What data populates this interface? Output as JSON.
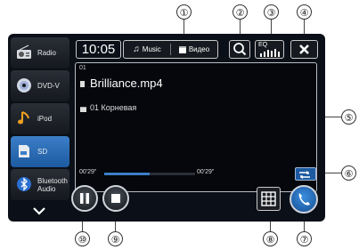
{
  "status": {
    "clock": "10:05"
  },
  "sources": [
    {
      "label": "Radio",
      "icon": "radio-icon",
      "active": false
    },
    {
      "label": "DVD-V",
      "icon": "disc-icon",
      "active": false
    },
    {
      "label": "iPod",
      "icon": "music-note-icon",
      "active": false
    },
    {
      "label": "SD",
      "icon": "sd-card-icon",
      "active": true
    },
    {
      "label": "Bluetooth\nAudio",
      "icon": "bluetooth-icon",
      "active": false
    }
  ],
  "tabs": {
    "music": "Music",
    "video": "Видео"
  },
  "eq_label": "EQ",
  "track": {
    "number": "01",
    "file": "Brilliance.mp4",
    "folder": "01 Корневая"
  },
  "progress": {
    "elapsed": "00'29\"",
    "remaining": "00'29\"",
    "fraction": 0.5
  },
  "callouts": [
    "①",
    "②",
    "③",
    "④",
    "⑤",
    "⑥",
    "⑦",
    "⑧",
    "⑨",
    "⑩"
  ],
  "colors": {
    "accent": "#3b7fc8",
    "screen_bg": "#0b0f18",
    "active_tab": "#1d5aa0"
  }
}
